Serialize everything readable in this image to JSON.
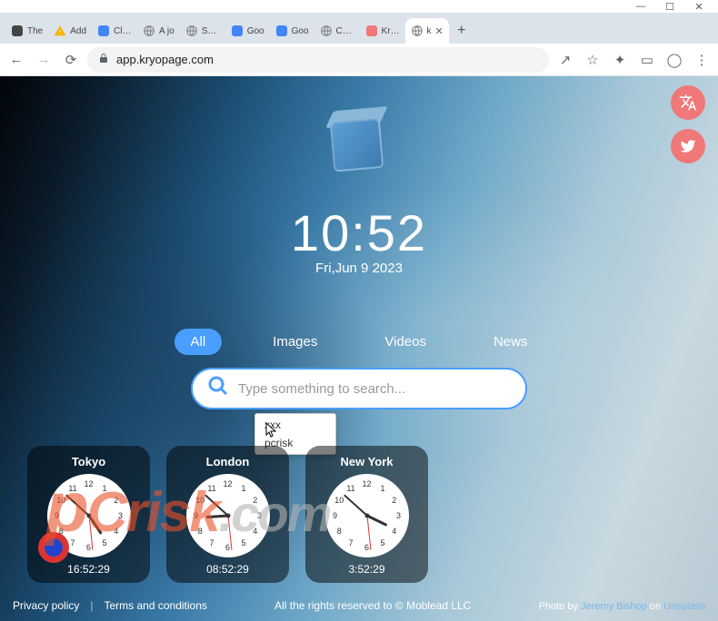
{
  "window": {
    "minimize": "—",
    "maximize": "☐",
    "close": "✕"
  },
  "tabs": [
    {
      "label": "The",
      "icon": "printer"
    },
    {
      "label": "Add",
      "icon": "warning"
    },
    {
      "label": "Click",
      "icon": "chrome"
    },
    {
      "label": "A jo",
      "icon": "globe"
    },
    {
      "label": "Scor",
      "icon": "globe"
    },
    {
      "label": "Goo",
      "icon": "google"
    },
    {
      "label": "Goo",
      "icon": "google"
    },
    {
      "label": "Com",
      "icon": "globe"
    },
    {
      "label": "Kryo",
      "icon": "kryo"
    },
    {
      "label": "k",
      "icon": "globe",
      "active": true
    }
  ],
  "newtab": "+",
  "nav": {
    "back": "←",
    "forward": "→",
    "reload": "⟳"
  },
  "address": {
    "lock_icon": "lock",
    "url": "app.kryopage.com"
  },
  "toolbar_icons": {
    "share": "↗",
    "star": "☆",
    "puzzle": "✦",
    "panel": "▭",
    "profile": "◯",
    "menu": "⋮"
  },
  "side": {
    "translate": "文A",
    "twitter": "twitter"
  },
  "main": {
    "time": "10:52",
    "date": "Fri,Jun 9 2023",
    "search_tabs": [
      {
        "label": "All",
        "active": true
      },
      {
        "label": "Images"
      },
      {
        "label": "Videos"
      },
      {
        "label": "News"
      }
    ],
    "search_placeholder": "Type something to search...",
    "suggestions": [
      "xxx",
      "pcrisk"
    ]
  },
  "clocks": [
    {
      "city": "Tokyo",
      "time": "16:52:29",
      "h": 4,
      "m": 52,
      "s": 29
    },
    {
      "city": "London",
      "time": "08:52:29",
      "h": 8,
      "m": 52,
      "s": 29
    },
    {
      "city": "New York",
      "time": "3:52:29",
      "h": 3,
      "m": 52,
      "s": 29
    }
  ],
  "footer": {
    "privacy": "Privacy policy",
    "terms": "Terms and conditions",
    "rights": "All the rights reserved to © Moblead LLC",
    "photo_prefix": "Photo by ",
    "photo_author": "Jeremy Bishop",
    "photo_on": " on ",
    "photo_site": "Unsplash"
  },
  "watermark": {
    "brand": "PCrisk",
    "tld": ".com"
  }
}
